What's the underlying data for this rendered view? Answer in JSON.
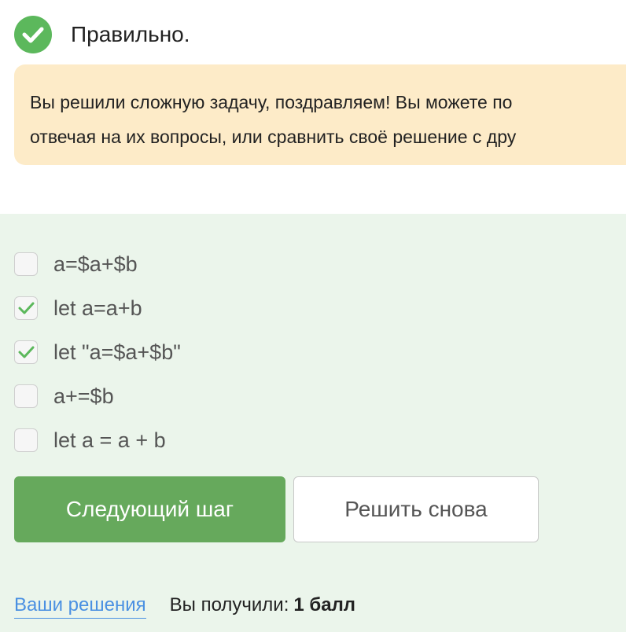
{
  "status": {
    "icon": "checkmark-circle-icon",
    "text": "Правильно.",
    "color": "#5cb85c"
  },
  "feedback": {
    "line1": "Вы решили сложную задачу, поздравляем! Вы можете по",
    "line2": "отвечая на их вопросы, или сравнить своё решение с дру",
    "background": "#fdebc8"
  },
  "options": [
    {
      "label": "a=$a+$b",
      "checked": false
    },
    {
      "label": "let a=a+b",
      "checked": true
    },
    {
      "label": "let \"a=$a+$b\"",
      "checked": true
    },
    {
      "label": "a+=$b",
      "checked": false
    },
    {
      "label": "let a = a + b",
      "checked": false
    }
  ],
  "buttons": {
    "next_label": "Следующий шаг",
    "retry_label": "Решить снова",
    "next_color": "#66a95c"
  },
  "footer": {
    "solutions_link": "Ваши решения",
    "score_prefix": "Вы получили:",
    "score_value": "1 балл"
  }
}
